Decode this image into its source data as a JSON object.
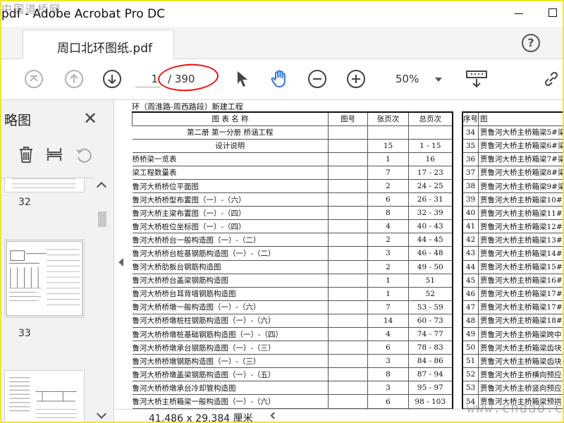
{
  "window": {
    "title": "pdf - Adobe Acrobat Pro DC",
    "watermark_left": "中国道桥网"
  },
  "tab": {
    "label": "周口北环图纸.pdf"
  },
  "toolbar": {
    "current_page": "1",
    "total_pages": "/ 390",
    "zoom": "50%"
  },
  "sidebar": {
    "title": "略图",
    "thumbnails": [
      {
        "label": "32"
      },
      {
        "label": "33"
      }
    ]
  },
  "document": {
    "header": "环（周淮路-周西路段）新建工程",
    "left_table": {
      "headers": {
        "name": "图 表 名 称",
        "fig": "图号",
        "pages": "张页次",
        "range": "总页次"
      },
      "rows": [
        {
          "name": "第二册 第一分册 桥涵工程",
          "pages": "",
          "range": "",
          "center": true
        },
        {
          "name": "设计说明",
          "pages": "15",
          "range": "1 - 15",
          "center": true
        },
        {
          "name": "桥桥梁一览表",
          "pages": "1",
          "range": "16"
        },
        {
          "name": "梁工程数量表",
          "pages": "7",
          "range": "17 - 23"
        },
        {
          "name": "鲁河大桥桥位平面图",
          "pages": "2",
          "range": "24 - 25"
        },
        {
          "name": "鲁河大桥桥型布置图（一）-（六）",
          "pages": "6",
          "range": "26 - 31"
        },
        {
          "name": "鲁河大桥主梁布置图（一）-（四）",
          "pages": "8",
          "range": "32 - 39"
        },
        {
          "name": "鲁河大桥桩位坐标图（一）-（四）",
          "pages": "4",
          "range": "40 - 43"
        },
        {
          "name": "鲁河大桥桥台一般构造图（一）-（二）",
          "pages": "2",
          "range": "44 - 45"
        },
        {
          "name": "鲁河大桥桥台桩基钢筋构造图（一）-（二）",
          "pages": "3",
          "range": "46 - 48"
        },
        {
          "name": "鲁河大桥肋板台钢筋构造图",
          "pages": "2",
          "range": "49 - 50"
        },
        {
          "name": "鲁河大桥桥台盖梁钢筋构造图",
          "pages": "1",
          "range": "51"
        },
        {
          "name": "鲁河大桥桥台耳背墙钢筋构造图",
          "pages": "1",
          "range": "52"
        },
        {
          "name": "鲁河大桥桥墩一般构造图（一）-（六）",
          "pages": "7",
          "range": "53 - 59"
        },
        {
          "name": "鲁河大桥桥墩桩柱钢筋构造图（一）-（六）",
          "pages": "14",
          "range": "60 - 73"
        },
        {
          "name": "鲁河大桥桥墩桩基础钢筋构造图（一）-（四）",
          "pages": "4",
          "range": "74 - 77"
        },
        {
          "name": "鲁河大桥桥墩承台钢筋构造图（一）-（三）",
          "pages": "6",
          "range": "78 - 83"
        },
        {
          "name": "鲁河大桥桥墩钢筋构造图（一）-（三）",
          "pages": "3",
          "range": "84 - 86"
        },
        {
          "name": "鲁河大桥桥墩盖梁钢筋构造图（一）-（五）",
          "pages": "8",
          "range": "87 - 94"
        },
        {
          "name": "鲁河大桥桥墩承台冷却管构造图",
          "pages": "3",
          "range": "95 - 97"
        },
        {
          "name": "鲁河大桥主桥箱梁一般构造图（一）-（六）",
          "pages": "6",
          "range": "98 - 103"
        }
      ]
    },
    "right_table": {
      "headers": {
        "seq": "序号",
        "name": "图"
      },
      "rows": [
        {
          "seq": "34",
          "name": "贾鲁河大桥主桥箱梁5#梁"
        },
        {
          "seq": "35",
          "name": "贾鲁河大桥主桥箱梁6#梁"
        },
        {
          "seq": "36",
          "name": "贾鲁河大桥主桥箱梁7#梁"
        },
        {
          "seq": "37",
          "name": "贾鲁河大桥主桥箱梁8#梁"
        },
        {
          "seq": "38",
          "name": "贾鲁河大桥主桥箱梁9#梁"
        },
        {
          "seq": "39",
          "name": "贾鲁河大桥主桥箱梁10#梁"
        },
        {
          "seq": "40",
          "name": "贾鲁河大桥主桥箱梁11#梁"
        },
        {
          "seq": "41",
          "name": "贾鲁河大桥主桥箱梁12#梁"
        },
        {
          "seq": "42",
          "name": "贾鲁河大桥主桥箱梁13#梁"
        },
        {
          "seq": "43",
          "name": "贾鲁河大桥主桥箱梁14#梁"
        },
        {
          "seq": "44",
          "name": "贾鲁河大桥主桥箱梁15#梁"
        },
        {
          "seq": "45",
          "name": "贾鲁河大桥主桥箱梁16#梁"
        },
        {
          "seq": "46",
          "name": "贾鲁河大桥主桥箱梁17#边"
        },
        {
          "seq": "47",
          "name": "贾鲁河大桥主桥箱梁17#中"
        },
        {
          "seq": "48",
          "name": "贾鲁河大桥主桥箱梁18#边"
        },
        {
          "seq": "49",
          "name": "贾鲁河大桥主桥箱梁跨中"
        },
        {
          "seq": "50",
          "name": "贾鲁河大桥主桥箱梁齿块"
        },
        {
          "seq": "51",
          "name": "贾鲁河大桥主桥箱梁齿块"
        },
        {
          "seq": "52",
          "name": "贾鲁河大桥主桥横向预应"
        },
        {
          "seq": "53",
          "name": "贾鲁河大桥主桥竖向预应"
        },
        {
          "seq": "54",
          "name": "贾鲁河大桥主桥箱梁预拱"
        }
      ]
    }
  },
  "status": {
    "page_size": "41.486 x 29.384 厘米"
  },
  "watermark_right": "www.cndao.com",
  "colors": {
    "accent_blue": "#2a73d9",
    "annotation_red": "#e11111",
    "outer_frame": "#f0e42a"
  }
}
